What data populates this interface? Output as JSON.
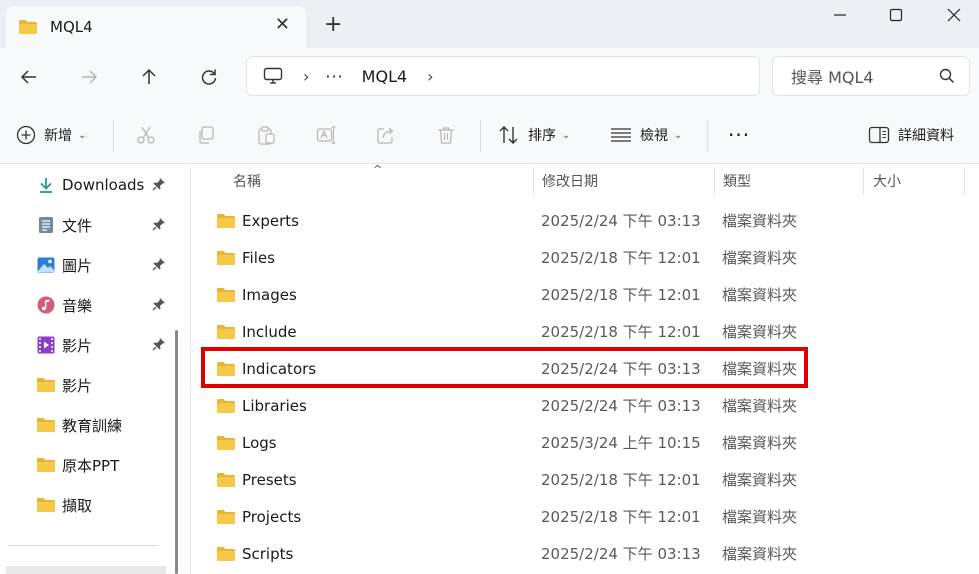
{
  "window": {
    "tab_title": "MQL4",
    "new_tab_symbol": "+",
    "close_tab_symbol": "✕"
  },
  "address": {
    "more_symbol": "···",
    "current_folder": "MQL4",
    "search_placeholder": "搜尋 MQL4"
  },
  "toolbar": {
    "new_label": "新增",
    "sort_label": "排序",
    "view_label": "檢視",
    "more_label": "···",
    "details_label": "詳細資料"
  },
  "sidebar": {
    "items": [
      {
        "label": "Downloads",
        "icon": "download-icon",
        "pinned": true
      },
      {
        "label": "文件",
        "icon": "document-icon",
        "pinned": true
      },
      {
        "label": "圖片",
        "icon": "pictures-icon",
        "pinned": true
      },
      {
        "label": "音樂",
        "icon": "music-icon",
        "pinned": true
      },
      {
        "label": "影片",
        "icon": "video-icon",
        "pinned": true
      },
      {
        "label": "影片",
        "icon": "folder-icon",
        "pinned": false
      },
      {
        "label": "教育訓練",
        "icon": "folder-icon",
        "pinned": false
      },
      {
        "label": "原本PPT",
        "icon": "folder-icon",
        "pinned": false
      },
      {
        "label": "擷取",
        "icon": "folder-icon",
        "pinned": false
      }
    ]
  },
  "columns": {
    "name": "名稱",
    "date": "修改日期",
    "type": "類型",
    "size": "大小"
  },
  "files": [
    {
      "name": "Experts",
      "date": "2025/2/24 下午 03:13",
      "type": "檔案資料夾"
    },
    {
      "name": "Files",
      "date": "2025/2/18 下午 12:01",
      "type": "檔案資料夾"
    },
    {
      "name": "Images",
      "date": "2025/2/18 下午 12:01",
      "type": "檔案資料夾"
    },
    {
      "name": "Include",
      "date": "2025/2/18 下午 12:01",
      "type": "檔案資料夾"
    },
    {
      "name": "Indicators",
      "date": "2025/2/24 下午 03:13",
      "type": "檔案資料夾",
      "highlighted": true
    },
    {
      "name": "Libraries",
      "date": "2025/2/24 下午 03:13",
      "type": "檔案資料夾"
    },
    {
      "name": "Logs",
      "date": "2025/3/24 上午 10:15",
      "type": "檔案資料夾"
    },
    {
      "name": "Presets",
      "date": "2025/2/18 下午 12:01",
      "type": "檔案資料夾"
    },
    {
      "name": "Projects",
      "date": "2025/2/18 下午 12:01",
      "type": "檔案資料夾"
    },
    {
      "name": "Scripts",
      "date": "2025/2/24 下午 03:13",
      "type": "檔案資料夾"
    }
  ],
  "colors": {
    "highlight": "#e00000",
    "folder": "#f7c948",
    "folder_dark": "#e9b431"
  }
}
